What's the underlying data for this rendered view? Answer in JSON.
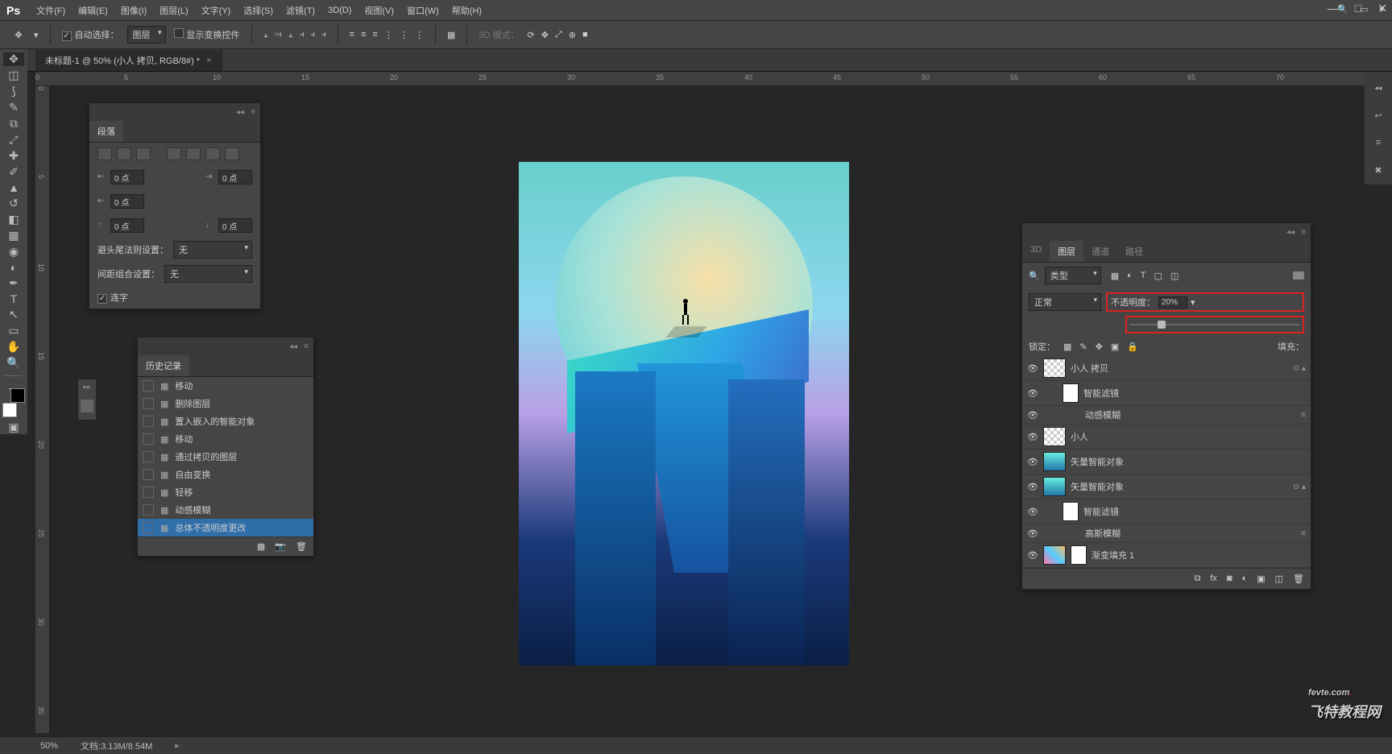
{
  "menubar": {
    "items": [
      "文件(F)",
      "编辑(E)",
      "图像(I)",
      "图层(L)",
      "文字(Y)",
      "选择(S)",
      "滤镜(T)",
      "3D(D)",
      "视图(V)",
      "窗口(W)",
      "帮助(H)"
    ]
  },
  "optbar": {
    "auto_select": "自动选择：",
    "layer_dd": "图层",
    "show_transform": "显示变换控件",
    "mode3d": "3D 模式："
  },
  "doctab": {
    "title": "未标题-1 @ 50% (小人 拷贝, RGB/8#) *"
  },
  "ruler": {
    "h": [
      "0",
      "5",
      "10",
      "15",
      "20",
      "25",
      "30",
      "35",
      "40",
      "45",
      "50",
      "55",
      "60",
      "65",
      "70"
    ],
    "v": [
      "0",
      "5",
      "10",
      "15",
      "20",
      "25",
      "30",
      "35"
    ]
  },
  "para": {
    "title": "段落",
    "v1": "0 点",
    "v2": "0 点",
    "v3": "0 点",
    "v4": "0 点",
    "v5": "0 点",
    "rule": "避头尾法则设置：",
    "rule_v": "无",
    "spacing": "间距组合设置：",
    "spacing_v": "无",
    "hyph": "连字"
  },
  "hist": {
    "title": "历史记录",
    "items": [
      "移动",
      "删除图层",
      "置入嵌入的智能对象",
      "移动",
      "通过拷贝的图层",
      "自由变换",
      "轻移",
      "动感模糊",
      "总体不透明度更改"
    ]
  },
  "layers": {
    "tabs": [
      "3D",
      "图层",
      "通道",
      "路径"
    ],
    "kind": "类型",
    "blend": "正常",
    "op_label": "不透明度：",
    "op_val": "20%",
    "lock": "锁定：",
    "fill": "填充：",
    "items": [
      {
        "name": "小人 拷贝",
        "eye": true,
        "thumb": "trans",
        "fx": true
      },
      {
        "name": "智能滤镜",
        "eye": true,
        "thumb": "mask",
        "indent": 1
      },
      {
        "name": "动感模糊",
        "eye": true,
        "indent": 2,
        "nothumb": true,
        "slider": true
      },
      {
        "name": "小人",
        "eye": true,
        "thumb": "trans"
      },
      {
        "name": "矢量智能对象",
        "eye": true,
        "thumb": "art"
      },
      {
        "name": "矢量智能对象",
        "eye": true,
        "thumb": "art",
        "fx": true
      },
      {
        "name": "智能滤镜",
        "eye": true,
        "thumb": "mask",
        "indent": 1
      },
      {
        "name": "高斯模糊",
        "eye": true,
        "indent": 2,
        "nothumb": true,
        "slider": true
      },
      {
        "name": "渐变填充 1",
        "eye": true,
        "thumb": "grad",
        "mask": true
      }
    ]
  },
  "status": {
    "zoom": "50%",
    "doc": "文档:3.13M/8.54M"
  },
  "watermark": {
    "en": "fevte.com",
    "cn": "飞特教程网"
  }
}
